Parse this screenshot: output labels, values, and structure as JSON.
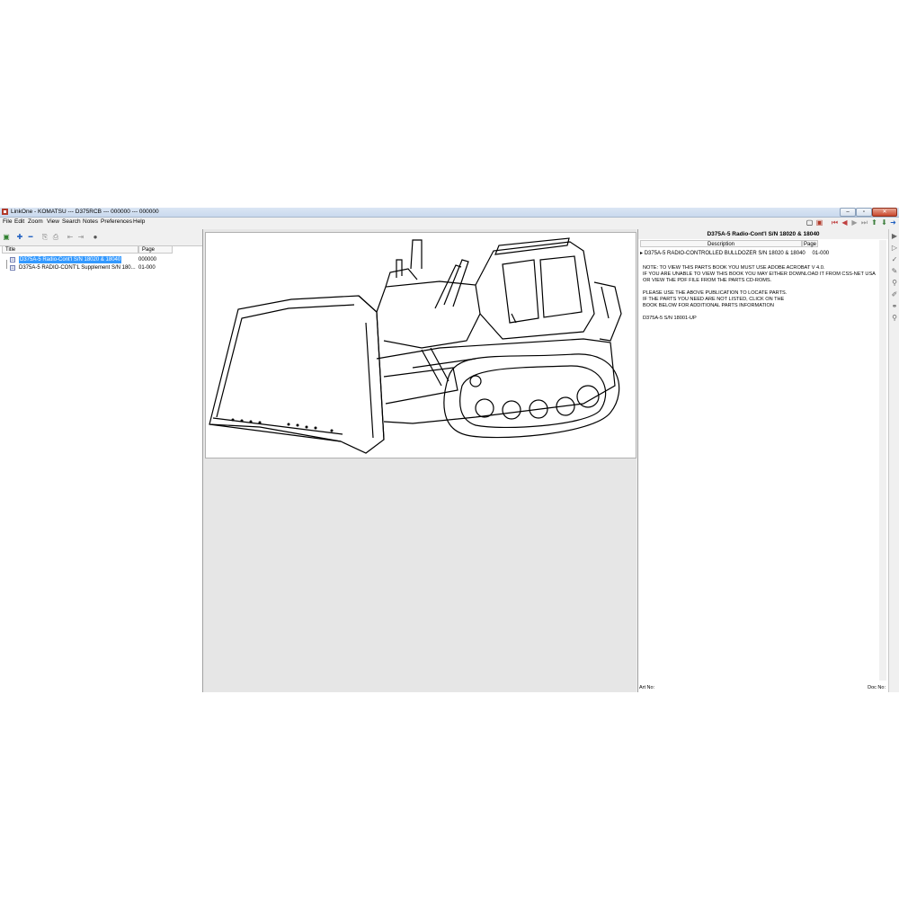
{
  "window": {
    "title": "LinkOne - KOMATSU --- D375RCB --- 000000 --- 000000"
  },
  "menu": {
    "file": "File",
    "edit": "Edit",
    "zoom": "Zoom",
    "view": "View",
    "search": "Search",
    "notes": "Notes",
    "preferences": "Preferences",
    "help": "Help"
  },
  "left": {
    "col_title": "Title",
    "col_page": "Page",
    "rows": [
      {
        "title": "D375A-5 Radio-Cont'l S/N 18020 & 18040",
        "page": "000000"
      },
      {
        "title": "D375A-5 RADIO-CONT'L Supplement S/N 180...",
        "page": "01-000"
      }
    ]
  },
  "right": {
    "header": "D375A-5 Radio-Cont'l S/N 18020 & 18040",
    "col_description": "Description",
    "col_page": "Page",
    "row": {
      "description": "D375A-5 RADIO-CONTROLLED BULLDOZER S/N 18020 & 18040",
      "page": "01-000"
    },
    "lines": [
      "NOTE: TO VIEW THIS PARTS BOOK YOU MUST USE ADOBE ACROBAT V 4.0.",
      "IF YOU ARE UNABLE TO VIEW THIS BOOK YOU MAY EITHER DOWNLOAD IT FROM CSS-NET USA",
      "OR VIEW THE PDF FILE FROM THE PARTS CD-ROMS.",
      "",
      "PLEASE USE THE ABOVE PUBLICATION TO LOCATE PARTS.",
      "IF THE PARTS YOU NEED ARE NOT LISTED, CLICK ON THE",
      "BOOK BELOW FOR ADDITIONAL PARTS INFORMATION",
      "",
      "D375A-5 S/N 18001-UP"
    ],
    "art_no_label": "Art No:",
    "doc_no_label": "Doc No:"
  },
  "colors": {
    "selection": "#3399ff",
    "titlebar": "#c9d9ee"
  },
  "icons": [
    "save-icon",
    "expand-icon",
    "collapse-icon",
    "copy-icon",
    "print-icon",
    "back-icon",
    "forward-icon",
    "info-icon",
    "first-icon",
    "previous-icon",
    "next-icon",
    "last-icon",
    "up-icon",
    "go-icon",
    "pick-icon",
    "check-icon",
    "note-icon",
    "link-icon",
    "search-icon"
  ]
}
